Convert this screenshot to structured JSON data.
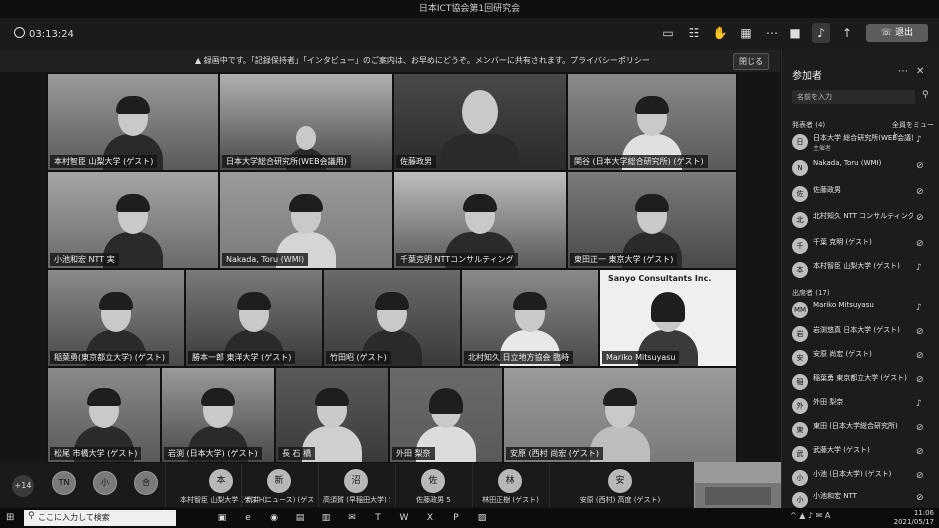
{
  "window": {
    "title": "日本ICT協会第1回研究会"
  },
  "toolbar": {
    "timer": "03:13:24",
    "leave_label": "退出",
    "icons": [
      "chat-icon",
      "participants-icon",
      "raise-hand-icon",
      "more-icon",
      "camera-icon",
      "mic-icon",
      "share-icon"
    ]
  },
  "banner": {
    "text": "▲ 録画中です。「記録保持者」「インタビュー」のご案内は、お早めにどうぞ。メンバーに共有されます。プライバシーポリシー",
    "close_label": "閉じる"
  },
  "tiles": [
    {
      "name": "本村智臣 山梨大学 (ゲスト)"
    },
    {
      "name": "日本大学総合研究所(WEB会議用)"
    },
    {
      "name": "佐藤政男"
    },
    {
      "name": "関谷 (日本大学総合研究所) (ゲスト)"
    },
    {
      "name": "小池和宏 NTT 実"
    },
    {
      "name": "Nakada, Toru (WMI)"
    },
    {
      "name": "千葉克明 NTTコンサルティング"
    },
    {
      "name": "東田正一 東京大学 (ゲスト)"
    },
    {
      "name": "稲葉勇(東京都立大学) (ゲスト)"
    },
    {
      "name": "勝本一郎 東洋大学 (ゲスト)"
    },
    {
      "name": "竹田昭 (ゲスト)"
    },
    {
      "name": "北村知久 日立地方協会 臨時"
    },
    {
      "name": "Mariko Mitsuyasu",
      "logo": "Sanyo Consultants Inc."
    },
    {
      "name": "松尾 市橋大学 (ゲスト)"
    },
    {
      "name": "岩渕 (日本大学) (ゲスト)"
    },
    {
      "name": "長 石 橋"
    },
    {
      "name": "外田 梨奈"
    },
    {
      "name": "安原 (西村 尚宏 (ゲスト)"
    }
  ],
  "strip": {
    "more": "+14",
    "chips": [
      "TN",
      "小",
      "合"
    ],
    "wide": [
      {
        "initial": "本",
        "name": "本村智臣 山梨大学 (ゲスト)"
      },
      {
        "initial": "新",
        "name": "新井 (ニュース) (ゲスト)"
      },
      {
        "initial": "沼",
        "name": "高須賀 (早稲田大学) 5"
      },
      {
        "initial": "佐",
        "name": "佐藤政男 5"
      },
      {
        "initial": "林",
        "name": "林田正樹 (ゲスト)"
      },
      {
        "initial": "安",
        "name": "安原 (西村) 高度 (ゲスト)"
      }
    ]
  },
  "panel": {
    "title": "参加者",
    "search_placeholder": "名前を入力",
    "section_presenters": "発表者 (4)",
    "mute_all": "全員をミュート",
    "presenters": [
      {
        "initial": "日",
        "name": "日本大学 総合研究所(WEB会議)",
        "role": "主催者"
      },
      {
        "initial": "N",
        "name": "Nakada, Toru (WMI)",
        "role": ""
      },
      {
        "initial": "佐",
        "name": "佐藤政男",
        "role": ""
      },
      {
        "initial": "北",
        "name": "北村知久 NTT コンサルティング",
        "role": ""
      },
      {
        "initial": "千",
        "name": "千葉 克明 (ゲスト)",
        "role": ""
      },
      {
        "initial": "本",
        "name": "本村智臣 山梨大学 (ゲスト)",
        "role": ""
      }
    ],
    "section_attendees": "出席者 (17)",
    "attendees": [
      {
        "initial": "MM",
        "name": "Mariko Mitsuyasu",
        "role": ""
      },
      {
        "initial": "岩",
        "name": "岩渕悠真 日本大学 (ゲスト)",
        "role": ""
      },
      {
        "initial": "安",
        "name": "安原 尚宏 (ゲスト)",
        "role": ""
      },
      {
        "initial": "稲",
        "name": "稲葉勇 東京都立大学 (ゲスト)",
        "role": ""
      },
      {
        "initial": "外",
        "name": "外田 梨奈",
        "role": ""
      },
      {
        "initial": "東",
        "name": "東田 (日本大学総合研究所)",
        "role": ""
      },
      {
        "initial": "武",
        "name": "武藤大学 (ゲスト)",
        "role": ""
      },
      {
        "initial": "小",
        "name": "小池 (日本大学) (ゲスト)",
        "role": ""
      },
      {
        "initial": "小",
        "name": "小池和宏 NTT",
        "role": ""
      }
    ]
  },
  "taskbar": {
    "search_placeholder": "ここに入力して検索",
    "time": "11:06",
    "date": "2021/05/17"
  }
}
